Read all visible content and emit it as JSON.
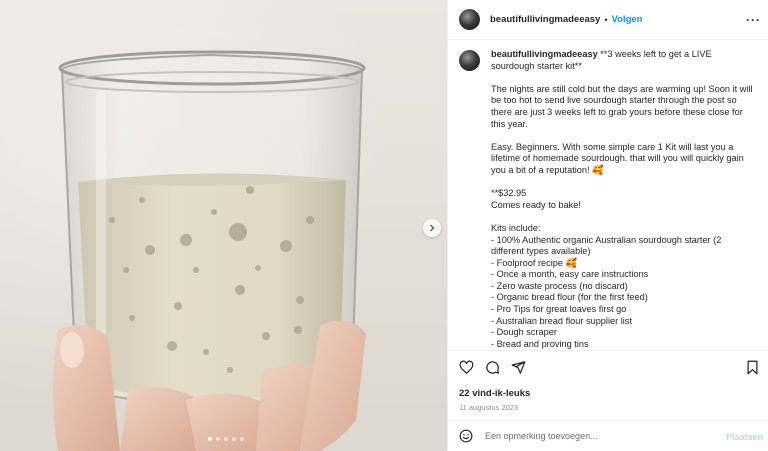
{
  "post": {
    "username": "beautifullivingmadeeasy",
    "separator": "•",
    "follow_label": "Volgen",
    "more_label": "···",
    "caption": "**3 weeks left to get a LIVE sourdough starter kit**\n\nThe nights are still cold but the days are warming up! Soon it will be too hot to send live sourdough starter through the post so there are just 3 weeks left to grab yours before these close for this year.\n\nEasy. Beginners. With some simple care 1 Kit will last you a lifetime of homemade sourdough. that will you will quickly gain you a bit of a reputation! 🥰\n\n**$32.95\nComes ready to bake!\n\nKits include:\n- 100% Authentic organic Australian sourdough starter (2 different types available)\n- Foolproof recipe 🥰\n- Once a month, easy care instructions\n- Zero waste process (no discard)\n- Organic bread flour (for the first feed)\n- Pro Tips for great loaves first go\n- Australian bread flour supplier list\n- Dough scraper\n- Bread and proving tins",
    "likes": "22 vind-ik-leuks",
    "date": "11 augustus 2023"
  },
  "comment": {
    "placeholder": "Een opmerking toevoegen...",
    "post_label": "Plaatsen"
  },
  "icons": {
    "heart": "heart-icon",
    "comment": "comment-icon",
    "share": "share-icon",
    "bookmark": "bookmark-icon",
    "emoji": "emoji-icon",
    "next": "chevron-right-icon"
  },
  "colors": {
    "follow": "#0095f6",
    "post_disabled": "#b3dbff",
    "muted": "#8e8e8e"
  },
  "carousel": {
    "total": 5,
    "active": 1
  }
}
